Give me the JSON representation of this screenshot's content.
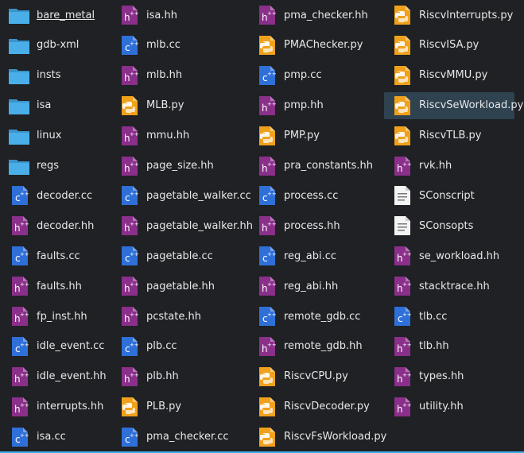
{
  "columns": [
    [
      "bare_metal",
      "gdb-xml",
      "insts",
      "isa",
      "linux",
      "regs",
      "decoder.cc",
      "decoder.hh",
      "faults.cc",
      "faults.hh",
      "fp_inst.hh",
      "idle_event.cc",
      "idle_event.hh",
      "interrupts.hh",
      "isa.cc"
    ],
    [
      "isa.hh",
      "mlb.cc",
      "mlb.hh",
      "MLB.py",
      "mmu.hh",
      "page_size.hh",
      "pagetable_walker.cc",
      "pagetable_walker.hh",
      "pagetable.cc",
      "pagetable.hh",
      "pcstate.hh",
      "plb.cc",
      "plb.hh",
      "PLB.py",
      "pma_checker.cc"
    ],
    [
      "pma_checker.hh",
      "PMAChecker.py",
      "pmp.cc",
      "pmp.hh",
      "PMP.py",
      "pra_constants.hh",
      "process.cc",
      "process.hh",
      "reg_abi.cc",
      "reg_abi.hh",
      "remote_gdb.cc",
      "remote_gdb.hh",
      "RiscvCPU.py",
      "RiscvDecoder.py",
      "RiscvFsWorkload.py"
    ],
    [
      "RiscvInterrupts.py",
      "RiscvISA.py",
      "RiscvMMU.py",
      "RiscvSeWorkload.py",
      "RiscvTLB.py",
      "rvk.hh",
      "SConscript",
      "SConsopts",
      "se_workload.hh",
      "stacktrace.hh",
      "tlb.cc",
      "tlb.hh",
      "types.hh",
      "utility.hh"
    ]
  ],
  "icons": {
    "folder": "folder-icon",
    ".cc": "cpp-source-icon",
    ".hh": "cpp-header-icon",
    ".py": "python-icon",
    "script": "text-file-icon"
  },
  "colors": {
    "background": "#1f2124",
    "folder": "#4aaee8",
    "source": "#2f6fd8",
    "header": "#8a2f8a",
    "python": "#f0a11b",
    "text": "#e8e8e8",
    "hover": "#2f4250",
    "accent": "#3daee9"
  },
  "state": {
    "hovered": "RiscvSeWorkload.py",
    "underlined": "bare_metal"
  }
}
